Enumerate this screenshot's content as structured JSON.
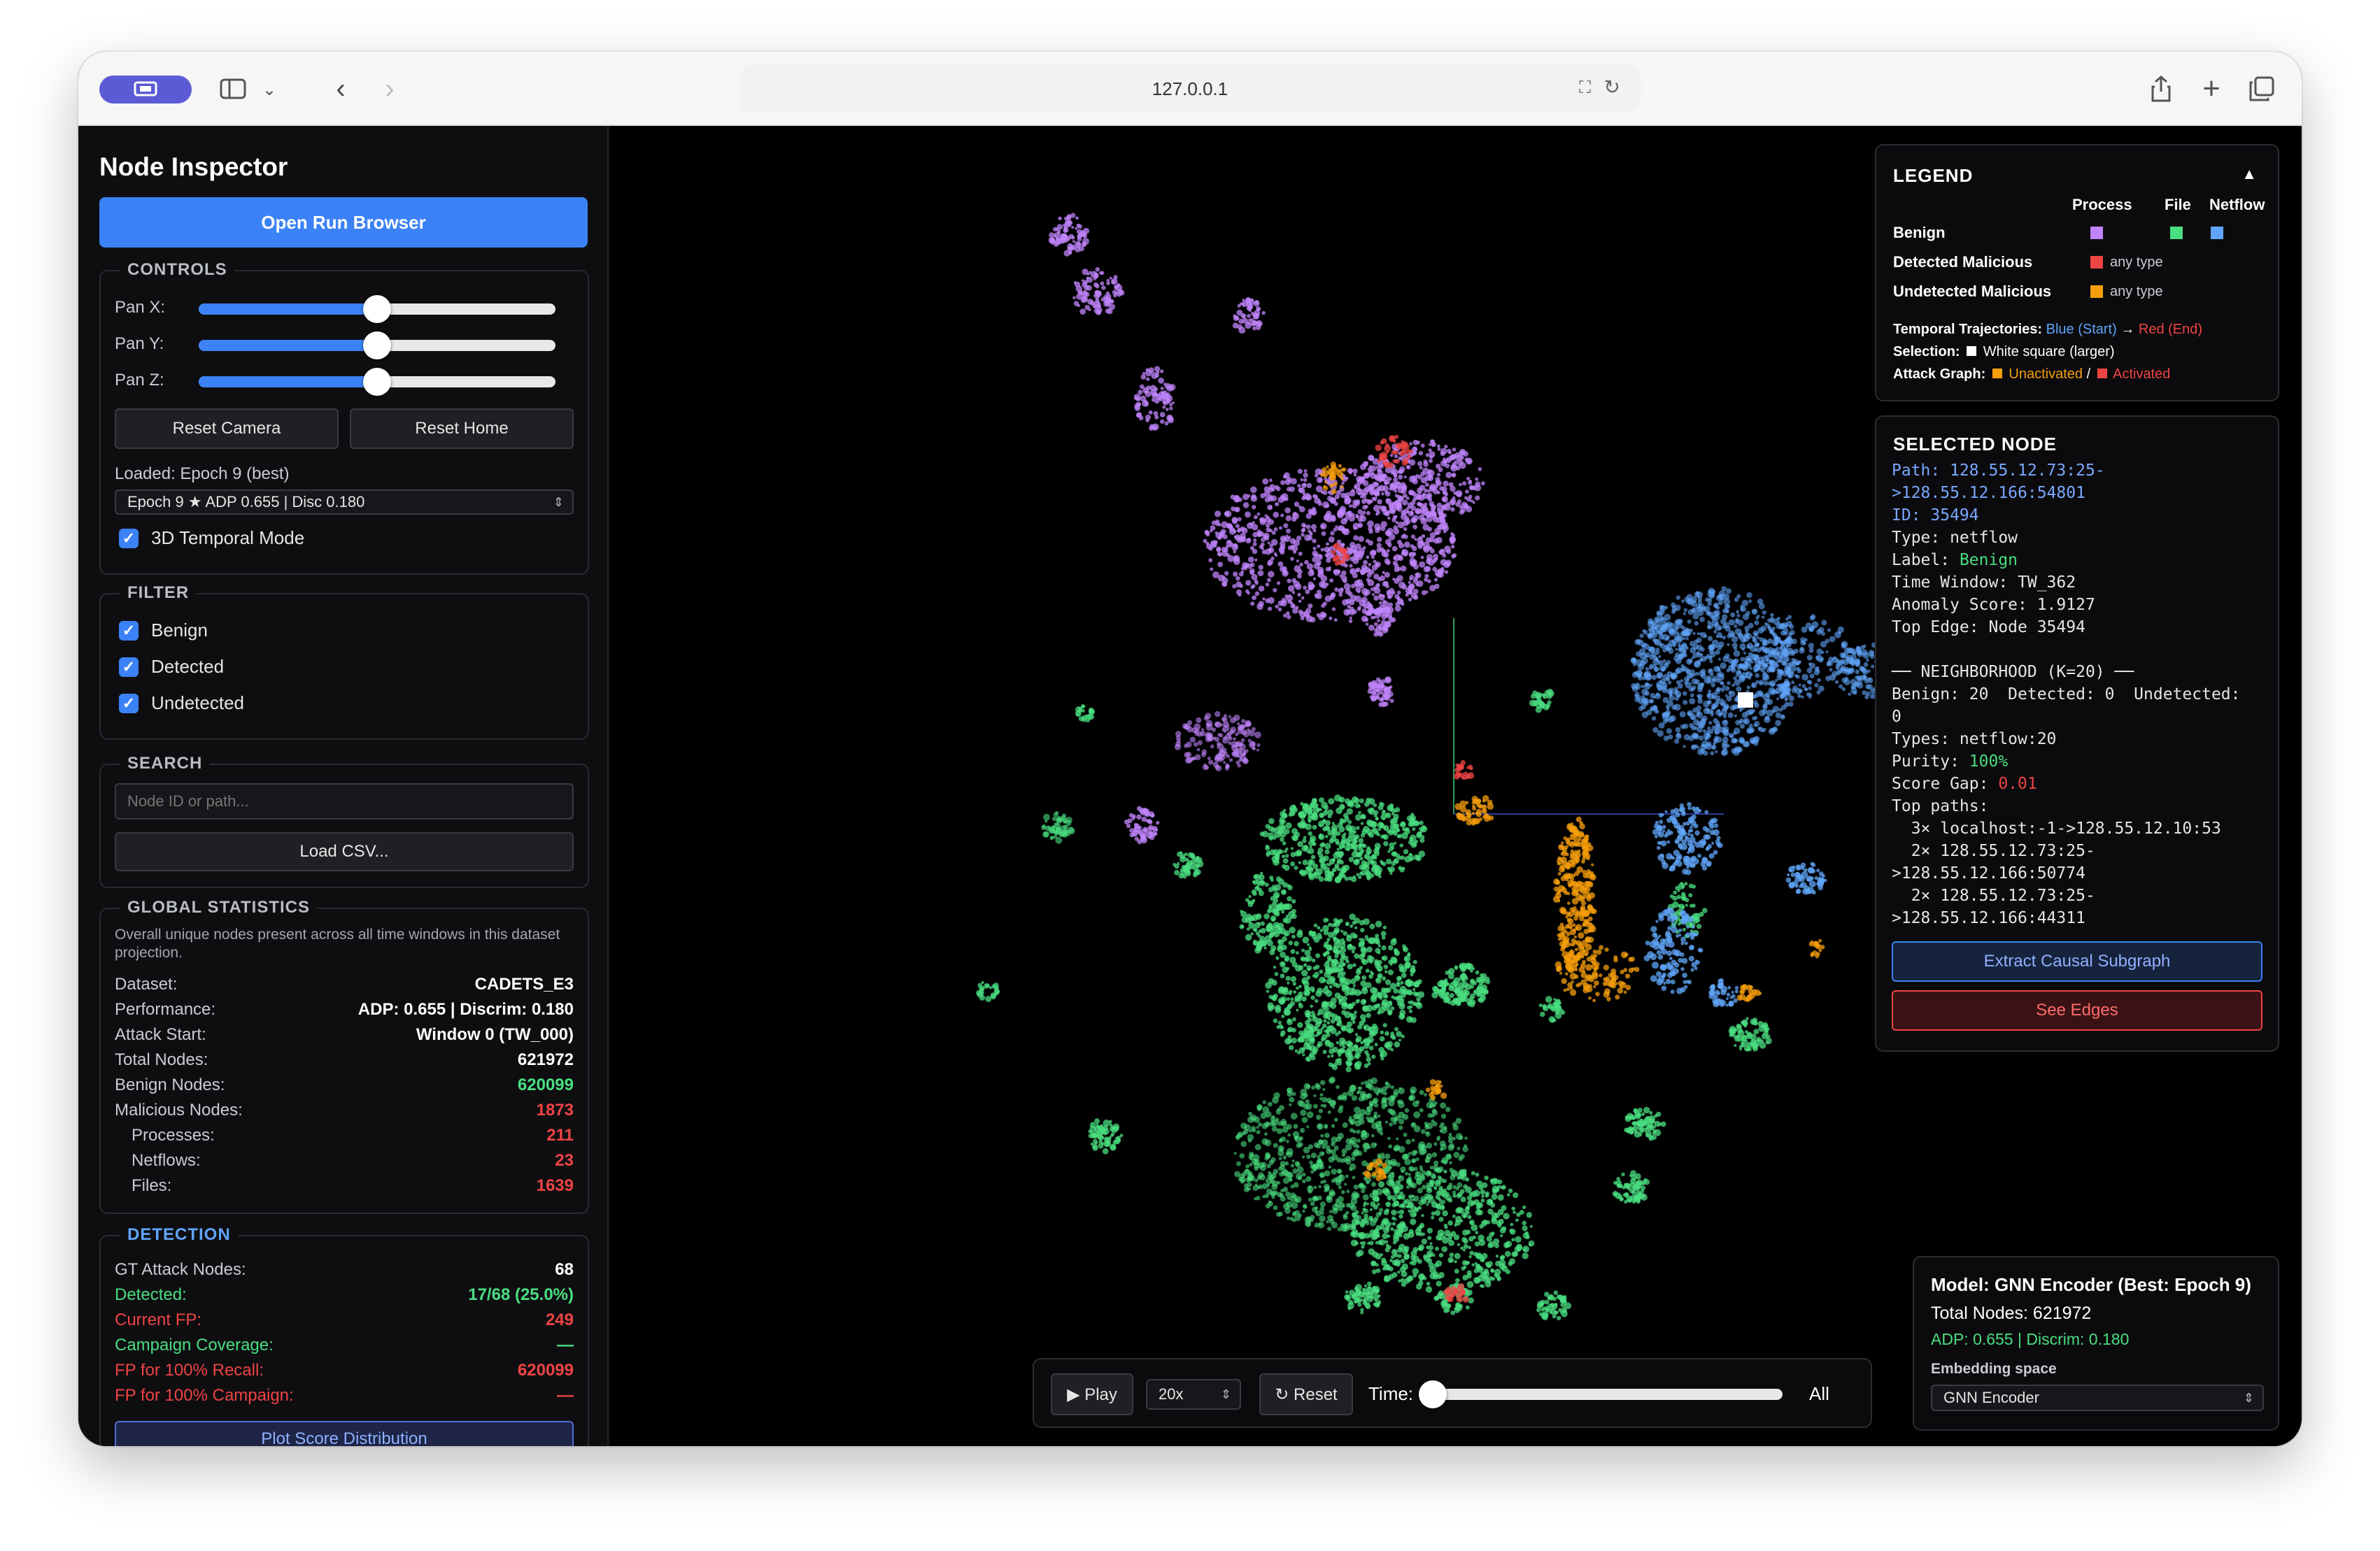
{
  "browser": {
    "url": "127.0.0.1"
  },
  "sidebar": {
    "title": "Node Inspector",
    "open_run_browser": "Open Run Browser",
    "controls": {
      "title": "CONTROLS",
      "pan_x_label": "Pan X:",
      "pan_y_label": "Pan Y:",
      "pan_z_label": "Pan Z:",
      "pan_x_value": 0.5,
      "pan_y_value": 0.5,
      "pan_z_value": 0.5,
      "reset_camera": "Reset Camera",
      "reset_home": "Reset Home",
      "loaded_label": "Loaded: Epoch 9 (best)",
      "epoch_select": "Epoch 9 ★ ADP 0.655 | Disc 0.180",
      "temporal_mode_label": "3D Temporal Mode",
      "temporal_mode_checked": true
    },
    "filter": {
      "title": "FILTER",
      "items": [
        {
          "label": "Benign",
          "checked": true
        },
        {
          "label": "Detected",
          "checked": true
        },
        {
          "label": "Undetected",
          "checked": true
        }
      ]
    },
    "search": {
      "title": "SEARCH",
      "placeholder": "Node ID or path...",
      "load_csv": "Load CSV..."
    },
    "global_stats": {
      "title": "GLOBAL STATISTICS",
      "description": "Overall unique nodes present across all time windows in this dataset projection.",
      "rows": [
        {
          "label": "Dataset:",
          "value": "CADETS_E3"
        },
        {
          "label": "Performance:",
          "value": "ADP: 0.655 | Discrim: 0.180"
        },
        {
          "label": "Attack Start:",
          "value": "Window 0 (TW_000)"
        },
        {
          "label": "Total Nodes:",
          "value": "621972"
        },
        {
          "label": "Benign Nodes:",
          "value": "620099"
        },
        {
          "label": "Malicious Nodes:",
          "value": "1873"
        },
        {
          "label": "Processes:",
          "value": "211"
        },
        {
          "label": "Netflows:",
          "value": "23"
        },
        {
          "label": "Files:",
          "value": "1639"
        }
      ]
    },
    "detection": {
      "title": "DETECTION",
      "rows": [
        {
          "label": "GT Attack Nodes:",
          "value": "68"
        },
        {
          "label": "Detected:",
          "value": "17/68 (25.0%)"
        },
        {
          "label": "Current FP:",
          "value": "249"
        },
        {
          "label": "Campaign Coverage:",
          "value": "—"
        },
        {
          "label": "FP for 100% Recall:",
          "value": "620099"
        },
        {
          "label": "FP for 100% Campaign:",
          "value": "—"
        }
      ],
      "plot_button": "Plot Score Distribution"
    }
  },
  "legend": {
    "title": "LEGEND",
    "collapse_icon": "▲",
    "col_process": "Process",
    "col_file": "File",
    "col_netflow": "Netflow",
    "row_benign": "Benign",
    "row_detected": "Detected Malicious",
    "row_undetected": "Undetected Malicious",
    "any_type": "any type",
    "colors": {
      "benign_process": "#c084fc",
      "benign_file": "#4ade80",
      "benign_netflow": "#60a5fa",
      "detected": "#ef4444",
      "undetected": "#f59e0b"
    },
    "temporal_label": "Temporal Trajectories:",
    "temporal_blue": "Blue (Start)",
    "temporal_arrow": "→",
    "temporal_red": "Red (End)",
    "selection_label": "Selection:",
    "selection_text": "White square (larger)",
    "attack_label": "Attack Graph:",
    "attack_unactivated": "Unactivated",
    "attack_sep": "/",
    "attack_activated": "Activated"
  },
  "selected_node": {
    "title": "SELECTED NODE",
    "path_line1": "Path: 128.55.12.73:25-",
    "path_line2": ">128.55.12.166:54801",
    "id_line": "ID: 35494",
    "type_line": "Type: netflow",
    "label_prefix": "Label: ",
    "label_value": "Benign",
    "time_window": "Time Window: TW_362",
    "anomaly": "Anomaly Score: 1.9127",
    "top_edge": "Top Edge: Node 35494",
    "neighborhood_header": "── NEIGHBORHOOD (K=20) ──",
    "neigh_counts": "Benign: 20  Detected: 0  Undetected:",
    "neigh_counts2": "0",
    "types": "Types: netflow:20",
    "purity_prefix": "Purity: ",
    "purity_value": "100%",
    "score_gap_prefix": "Score Gap: ",
    "score_gap_value": "0.01",
    "top_paths": "Top paths:",
    "paths": [
      "  3× localhost:-1->128.55.12.10:53",
      "  2× 128.55.12.73:25-",
      ">128.55.12.166:50774",
      "  2× 128.55.12.73:25-",
      ">128.55.12.166:44311"
    ],
    "extract_button": "Extract Causal Subgraph",
    "see_edges_button": "See Edges"
  },
  "model_card": {
    "title": "Model: GNN Encoder (Best: Epoch 9)",
    "total": "Total Nodes: 621972",
    "metrics": "ADP: 0.655 | Discrim: 0.180",
    "embedding_label": "Embedding space",
    "embedding_value": "GNN Encoder"
  },
  "playback": {
    "play": "▶ Play",
    "speed": "20x",
    "reset": "↻ Reset",
    "time_label": "Time:",
    "time_value": 0,
    "all_label": "All"
  }
}
